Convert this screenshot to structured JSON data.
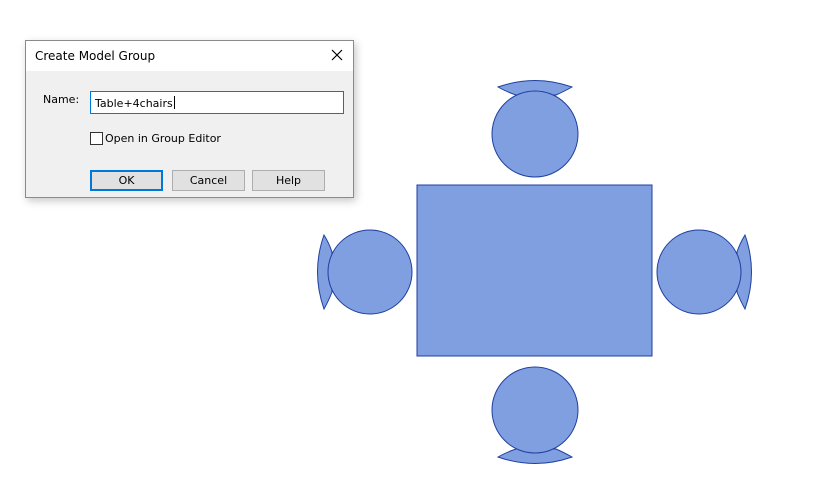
{
  "dialog": {
    "title": "Create Model Group",
    "close_icon": "close-icon",
    "name_label": "Name:",
    "name_value": "Table+4chairs",
    "open_in_editor_checked": false,
    "open_in_editor_label": "Open in Group Editor",
    "ok_label": "OK",
    "cancel_label": "Cancel",
    "help_label": "Help"
  },
  "canvas": {
    "fill_color": "#7f9fe0",
    "stroke_color": "#1e3fa0",
    "objects": [
      "table",
      "chair-top",
      "chair-left",
      "chair-right",
      "chair-bottom"
    ]
  }
}
